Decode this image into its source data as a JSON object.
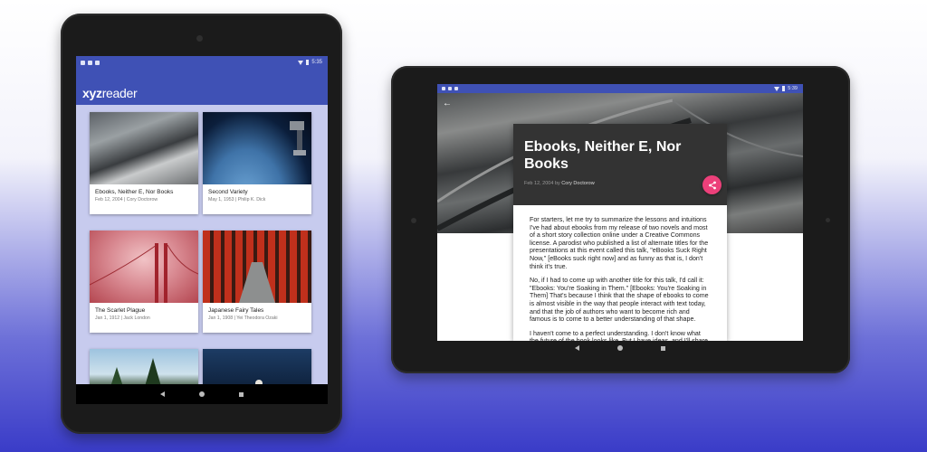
{
  "portrait": {
    "status_time": "5:35",
    "logo_bold": "xyz",
    "logo_light": "reader",
    "cards": [
      {
        "title": "Ebooks, Neither E, Nor Books",
        "meta": "Feb 12, 2004 | Cory Doctorow",
        "image": "architecture-roof"
      },
      {
        "title": "Second Variety",
        "meta": "May 1, 1953 | Philip K. Dick",
        "image": "earth-from-orbit"
      },
      {
        "title": "The Scarlet Plague",
        "meta": "Jan 1, 1912 | Jack London",
        "image": "foggy-bridge"
      },
      {
        "title": "Japanese Fairy Tales",
        "meta": "Jan 1, 1908 | Yei Theodora Ozaki",
        "image": "torii-gates"
      },
      {
        "title": "",
        "meta": "",
        "image": "lake-trees"
      },
      {
        "title": "",
        "meta": "",
        "image": "night-sky-person"
      }
    ]
  },
  "landscape": {
    "status_time": "5:39",
    "article": {
      "title": "Ebooks, Neither E, Nor Books",
      "date": "Feb 12, 2004",
      "by": "by",
      "author": "Cory Doctorow",
      "paragraphs": [
        "For starters, let me try to summarize the lessons and intuitions I've had about ebooks from my release of two novels and most of a short story collection online under a Creative Commons license. A parodist who published a list of alternate titles for the presentations at this event called this talk, \"eBooks Suck Right Now,\" [eBooks suck right now] and as funny as that is, I don't think it's true.",
        "No, if I had to come up with another title for this talk, I'd call it: \"Ebooks: You're Soaking in Them.\" [Ebooks: You're Soaking in Them] That's because I think that the shape of ebooks to come is almost visible in the way that people interact with text today, and that the job of authors who want to become rich and famous is to come to a better understanding of that shape.",
        "I haven't come to a perfect understanding. I don't know what the future of the book looks like. But I have ideas, and I'll share"
      ]
    }
  },
  "colors": {
    "primary": "#3f51b5",
    "accent": "#ec407a",
    "grid_bg": "#c7cbee",
    "article_header": "#333333"
  }
}
